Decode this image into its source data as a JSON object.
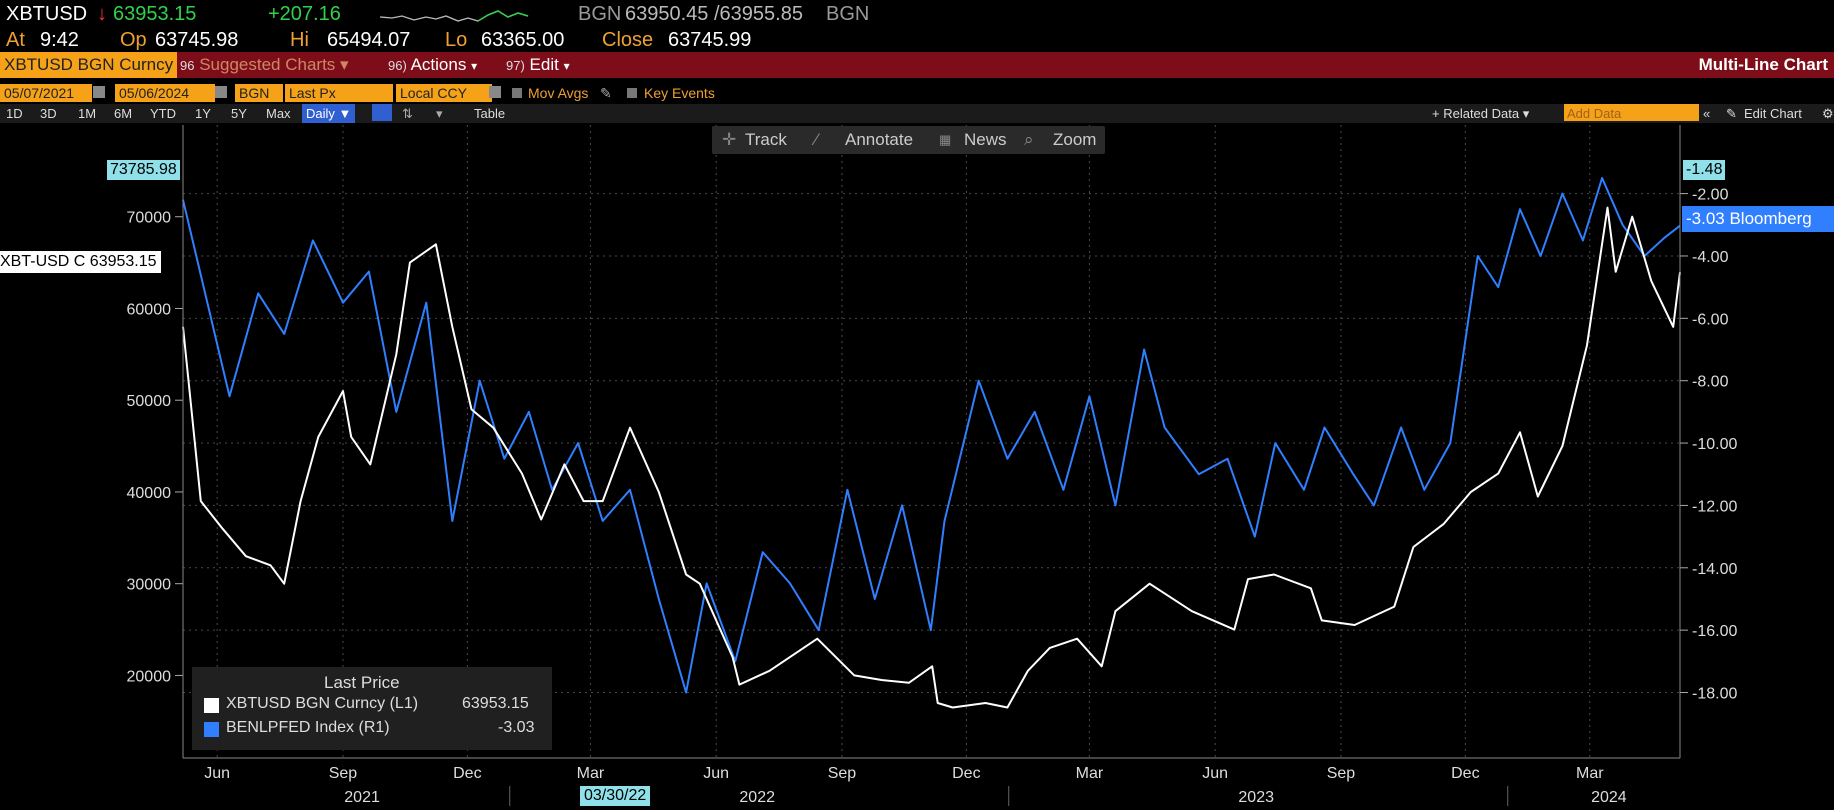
{
  "header": {
    "ticker": "XBTUSD",
    "arrow": "↓",
    "last": "63953.15",
    "change": "+207.16",
    "source_bid": "BGN",
    "bid_ask": "63950.45 /63955.85",
    "source_ask": "BGN",
    "at_label": "At",
    "at_time": "9:42",
    "op_label": "Op",
    "op": "63745.98",
    "hi_label": "Hi",
    "hi": "65494.07",
    "lo_label": "Lo",
    "lo": "63365.00",
    "close_label": "Close",
    "close": "63745.99"
  },
  "menubar": {
    "security": "XBTUSD BGN Curncy",
    "suggested_num": "96",
    "suggested": "Suggested Charts",
    "actions_num": "96)",
    "actions": "Actions",
    "edit_num": "97)",
    "edit": "Edit",
    "title": "Multi-Line Chart"
  },
  "controls": {
    "start_date": "05/07/2021",
    "end_date": "05/06/2024",
    "source": "BGN",
    "field": "Last Px",
    "currency": "Local CCY",
    "mov_avgs": "Mov Avgs",
    "key_events": "Key Events"
  },
  "periods": [
    "1D",
    "3D",
    "1M",
    "6M",
    "YTD",
    "1Y",
    "5Y",
    "Max"
  ],
  "toolbar": {
    "frequency": "Daily ▼",
    "table": "Table",
    "related": "+ Related Data ▾",
    "add_data": "Add Data",
    "edit_chart": "Edit Chart"
  },
  "tools": {
    "track": "Track",
    "annotate": "Annotate",
    "news": "News",
    "zoom": "Zoom"
  },
  "axis_tags": {
    "left_max": "73785.98",
    "left_last": "XBT-USD C 63953.15",
    "right_max": "-1.48",
    "right_last": "-3.03 Bloomberg"
  },
  "legend": {
    "title": "Last Price",
    "s1_name": "XBTUSD BGN Curncy (L1)",
    "s1_value": "63953.15",
    "s2_name": "BENLPFED Index (R1)",
    "s2_value": "-3.03"
  },
  "date_marker": "03/30/22",
  "colors": {
    "series1": "#ffffff",
    "series2": "#2f7fff",
    "accent": "#f5a218",
    "menubar": "#7d0e19"
  },
  "chart_data": {
    "type": "line",
    "x_axis": {
      "month_labels": [
        "Jun",
        "Sep",
        "Dec",
        "Mar",
        "Jun",
        "Sep",
        "Dec",
        "Mar",
        "Jun",
        "Sep",
        "Dec",
        "Mar"
      ],
      "month_dates": [
        "2021-06-01",
        "2021-09-01",
        "2021-12-01",
        "2022-03-01",
        "2022-06-01",
        "2022-09-01",
        "2022-12-01",
        "2023-03-01",
        "2023-06-01",
        "2023-09-01",
        "2023-12-01",
        "2024-03-01"
      ],
      "year_labels": [
        "2021",
        "2022",
        "2023",
        "2024"
      ],
      "year_dates": [
        "2021-09-15",
        "2022-07-01",
        "2023-07-01",
        "2024-03-15"
      ],
      "range": [
        "2021-05-07",
        "2024-05-06"
      ]
    },
    "left_axis": {
      "ticks": [
        20000,
        30000,
        40000,
        50000,
        60000,
        70000
      ],
      "range": [
        11000,
        80000
      ]
    },
    "right_axis": {
      "ticks": [
        -2.0,
        -4.0,
        -6.0,
        -8.0,
        -10.0,
        -12.0,
        -14.0,
        -16.0,
        -18.0
      ],
      "tick_labels": [
        "-2.00",
        "-4.00",
        "-6.00",
        "-8.00",
        "-10.00",
        "-12.00",
        "-14.00",
        "-16.00",
        "-18.00"
      ],
      "range": [
        -20.1,
        0.2
      ]
    },
    "series": [
      {
        "name": "XBTUSD BGN Curncy (L1)",
        "axis": "left",
        "x": [
          "2021-05-07",
          "2021-05-20",
          "2021-06-05",
          "2021-06-22",
          "2021-07-10",
          "2021-07-20",
          "2021-08-01",
          "2021-08-14",
          "2021-09-01",
          "2021-09-07",
          "2021-09-21",
          "2021-10-10",
          "2021-10-20",
          "2021-11-08",
          "2021-11-20",
          "2021-12-04",
          "2021-12-20",
          "2022-01-10",
          "2022-01-24",
          "2022-02-10",
          "2022-02-24",
          "2022-03-10",
          "2022-03-30",
          "2022-04-20",
          "2022-05-10",
          "2022-05-20",
          "2022-06-13",
          "2022-06-18",
          "2022-07-10",
          "2022-08-14",
          "2022-09-10",
          "2022-09-30",
          "2022-10-20",
          "2022-11-06",
          "2022-11-10",
          "2022-11-21",
          "2022-12-15",
          "2022-12-31",
          "2023-01-15",
          "2023-01-31",
          "2023-02-20",
          "2023-03-10",
          "2023-03-20",
          "2023-04-14",
          "2023-05-15",
          "2023-06-15",
          "2023-06-25",
          "2023-07-14",
          "2023-08-10",
          "2023-08-18",
          "2023-09-11",
          "2023-10-10",
          "2023-10-24",
          "2023-11-15",
          "2023-12-05",
          "2023-12-25",
          "2024-01-10",
          "2024-01-23",
          "2024-02-10",
          "2024-02-28",
          "2024-03-14",
          "2024-03-20",
          "2024-04-01",
          "2024-04-15",
          "2024-05-01",
          "2024-05-06"
        ],
        "values": [
          58000,
          39000,
          36000,
          33000,
          32000,
          30000,
          39000,
          46000,
          51000,
          46000,
          43000,
          55000,
          65000,
          67000,
          58000,
          49000,
          47000,
          42000,
          37000,
          43000,
          39000,
          39000,
          47000,
          40000,
          31000,
          30000,
          22000,
          19000,
          20500,
          24000,
          20000,
          19500,
          19200,
          21000,
          17000,
          16500,
          17000,
          16500,
          20500,
          23000,
          24000,
          21000,
          27000,
          30000,
          27000,
          25000,
          30500,
          31000,
          29500,
          26000,
          25500,
          27500,
          34000,
          36500,
          40000,
          42000,
          46500,
          39500,
          45000,
          56000,
          71000,
          64000,
          70000,
          63000,
          58000,
          63953.15
        ]
      },
      {
        "name": "BENLPFED Index (R1)",
        "axis": "right",
        "x": [
          "2021-05-07",
          "2021-06-10",
          "2021-07-01",
          "2021-07-20",
          "2021-08-10",
          "2021-09-01",
          "2021-09-20",
          "2021-10-10",
          "2021-11-01",
          "2021-11-20",
          "2021-12-10",
          "2021-12-28",
          "2022-01-15",
          "2022-02-01",
          "2022-02-20",
          "2022-03-10",
          "2022-03-30",
          "2022-04-20",
          "2022-05-10",
          "2022-05-25",
          "2022-06-15",
          "2022-07-05",
          "2022-07-25",
          "2022-08-15",
          "2022-09-05",
          "2022-09-25",
          "2022-10-15",
          "2022-11-05",
          "2022-11-15",
          "2022-12-10",
          "2022-12-31",
          "2023-01-20",
          "2023-02-10",
          "2023-03-01",
          "2023-03-20",
          "2023-04-10",
          "2023-04-25",
          "2023-05-20",
          "2023-06-10",
          "2023-06-30",
          "2023-07-15",
          "2023-08-05",
          "2023-08-20",
          "2023-09-10",
          "2023-09-25",
          "2023-10-15",
          "2023-11-01",
          "2023-11-20",
          "2023-12-10",
          "2023-12-25",
          "2024-01-10",
          "2024-01-25",
          "2024-02-10",
          "2024-02-25",
          "2024-03-10",
          "2024-03-25",
          "2024-04-10",
          "2024-04-25",
          "2024-05-06"
        ],
        "values": [
          -2.2,
          -8.5,
          -5.2,
          -6.5,
          -3.5,
          -5.5,
          -4.5,
          -9.0,
          -5.5,
          -12.5,
          -8.0,
          -10.5,
          -9.0,
          -11.5,
          -10.0,
          -12.5,
          -11.5,
          -15.0,
          -18.0,
          -14.5,
          -17.0,
          -13.5,
          -14.5,
          -16.0,
          -11.5,
          -15.0,
          -12.0,
          -16.0,
          -12.5,
          -8.0,
          -10.5,
          -9.0,
          -11.5,
          -8.5,
          -12.0,
          -7.0,
          -9.5,
          -11.0,
          -10.5,
          -13.0,
          -10.0,
          -11.5,
          -9.5,
          -11.0,
          -12.0,
          -9.5,
          -11.5,
          -10.0,
          -4.0,
          -5.0,
          -2.5,
          -4.0,
          -2.0,
          -3.5,
          -1.5,
          -3.0,
          -4.0,
          -3.4,
          -3.03
        ]
      }
    ]
  }
}
